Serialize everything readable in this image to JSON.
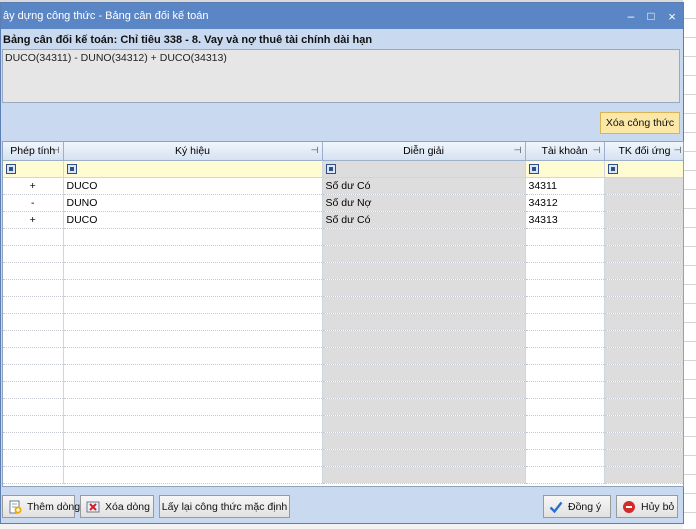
{
  "window": {
    "title": "ây dựng công thức - Bảng cân đối kế toán",
    "controls": {
      "minimize": "–",
      "maximize": "□",
      "close": "×"
    }
  },
  "formula": {
    "header": "Bảng cân đối kế toán: Chỉ tiêu 338 - 8. Vay và nợ thuê tài chính dài hạn",
    "text": "DUCO(34311) - DUNO(34312) + DUCO(34313)"
  },
  "toolbar": {
    "clear_label": "Xóa công thức"
  },
  "grid": {
    "columns": [
      "Phép tính",
      "Ký hiệu",
      "Diễn giải",
      "Tài khoản",
      "TK đối ứng"
    ],
    "rows": [
      {
        "op": "+",
        "code": "DUCO",
        "desc": "Số dư Có",
        "account": "34311",
        "counter": ""
      },
      {
        "op": "-",
        "code": "DUNO",
        "desc": "Số dư Nợ",
        "account": "34312",
        "counter": ""
      },
      {
        "op": "+",
        "code": "DUCO",
        "desc": "Số dư Có",
        "account": "34313",
        "counter": ""
      }
    ]
  },
  "footer": {
    "add_row": "Thêm dòng",
    "delete_row": "Xóa dòng",
    "reset": "Lấy lại công thức mặc định",
    "ok": "Đồng ý",
    "cancel": "Hủy bỏ"
  },
  "colors": {
    "titlebar": "#5b86c6",
    "dialog_bg": "#c9daf0",
    "clear_button": "#fbe7a6",
    "filter_row": "#fffbd2"
  }
}
